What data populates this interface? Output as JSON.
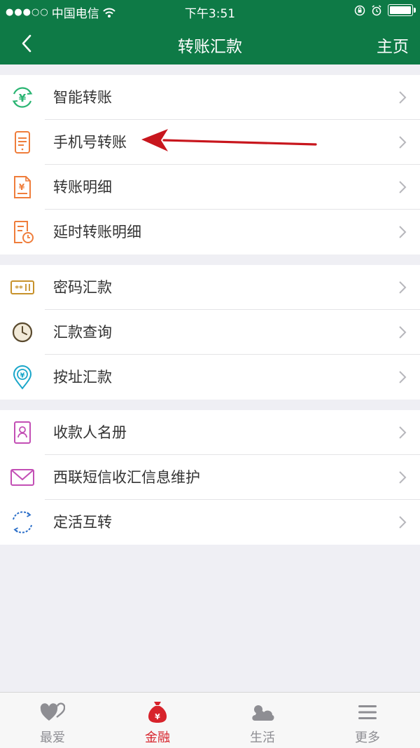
{
  "status": {
    "carrier": "中国电信",
    "time": "下午3:51"
  },
  "nav": {
    "title": "转账汇款",
    "home_label": "主页"
  },
  "groups": [
    [
      {
        "label": "智能转账",
        "icon": "smart-transfer-icon"
      },
      {
        "label": "手机号转账",
        "icon": "phone-transfer-icon"
      },
      {
        "label": "转账明细",
        "icon": "transfer-details-icon"
      },
      {
        "label": "延时转账明细",
        "icon": "delayed-transfer-icon"
      }
    ],
    [
      {
        "label": "密码汇款",
        "icon": "password-remittance-icon"
      },
      {
        "label": "汇款查询",
        "icon": "clock-icon"
      },
      {
        "label": "按址汇款",
        "icon": "location-pin-icon"
      }
    ],
    [
      {
        "label": "收款人名册",
        "icon": "payee-book-icon"
      },
      {
        "label": "西联短信收汇信息维护",
        "icon": "envelope-icon"
      },
      {
        "label": "定活互转",
        "icon": "fixed-demand-swap-icon"
      }
    ]
  ],
  "tabs": [
    {
      "label": "最爱",
      "icon": "heart-icon",
      "active": false
    },
    {
      "label": "金融",
      "icon": "money-bag-icon",
      "active": true
    },
    {
      "label": "生活",
      "icon": "cloud-icon",
      "active": false
    },
    {
      "label": "更多",
      "icon": "menu-icon",
      "active": false
    }
  ],
  "colors": {
    "brand_green": "#0e7a46",
    "active_red": "#d7232b",
    "annotation_arrow": "#c8161d"
  }
}
